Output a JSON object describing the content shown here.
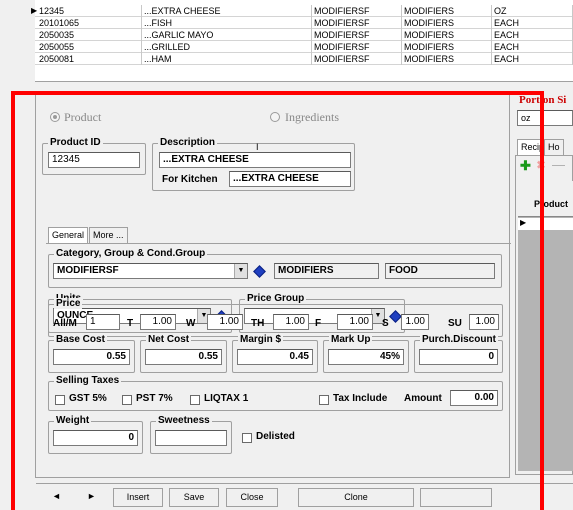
{
  "grid_rows": [
    {
      "id": "12345",
      "desc": "...EXTRA CHEESE",
      "c1": "MODIFIERSF",
      "c2": "MODIFIERS",
      "c3": "OZ",
      "selected": true
    },
    {
      "id": "20101065",
      "desc": "...FISH",
      "c1": "MODIFIERSF",
      "c2": "MODIFIERS",
      "c3": "EACH",
      "selected": false
    },
    {
      "id": "2050035",
      "desc": "...GARLIC MAYO",
      "c1": "MODIFIERSF",
      "c2": "MODIFIERS",
      "c3": "EACH",
      "selected": false
    },
    {
      "id": "2050055",
      "desc": "...GRILLED",
      "c1": "MODIFIERSF",
      "c2": "MODIFIERS",
      "c3": "EACH",
      "selected": false
    },
    {
      "id": "2050081",
      "desc": "...HAM",
      "c1": "MODIFIERSF",
      "c2": "MODIFIERS",
      "c3": "EACH",
      "selected": false
    }
  ],
  "mode": {
    "product": "Product",
    "ingredients": "Ingredients"
  },
  "product_id": {
    "label": "Product ID",
    "value": "12345"
  },
  "description": {
    "label": "Description",
    "value": "...EXTRA CHEESE",
    "kitchen_label": "For Kitchen",
    "kitchen_value": "...EXTRA CHEESE"
  },
  "tabs": {
    "general": "General",
    "more": "More ..."
  },
  "category": {
    "label": "Category, Group & Cond.Group",
    "value": "MODIFIERSF",
    "group": "MODIFIERS",
    "cond": "FOOD"
  },
  "units": {
    "label": "Units",
    "value": "OUNCE"
  },
  "price_group": {
    "label": "Price Group",
    "value": ""
  },
  "price": {
    "label": "Price",
    "allm_label": "All/M",
    "allm_value": "1",
    "items": [
      {
        "label": "T",
        "value": "1.00"
      },
      {
        "label": "W",
        "value": "1.00"
      },
      {
        "label": "TH",
        "value": "1.00"
      },
      {
        "label": "F",
        "value": "1.00"
      },
      {
        "label": "S",
        "value": "1.00"
      },
      {
        "label": "SU",
        "value": "1.00"
      }
    ]
  },
  "costs": {
    "base_label": "Base Cost",
    "base_value": "0.55",
    "net_label": "Net Cost",
    "net_value": "0.55",
    "margin_label": "Margin $",
    "margin_value": "0.45",
    "markup_label": "Mark Up",
    "markup_value": "45%",
    "discount_label": "Purch.Discount",
    "discount_value": "0"
  },
  "taxes": {
    "label": "Selling Taxes",
    "gst": "GST 5%",
    "pst": "PST 7%",
    "liq": "LIQTAX 1",
    "include": "Tax Include",
    "amount_label": "Amount",
    "amount_value": "0.00"
  },
  "weight": {
    "label": "Weight",
    "value": "0"
  },
  "sweetness": {
    "label": "Sweetness",
    "value": ""
  },
  "delisted": "Delisted",
  "toolbar": {
    "prev": "◄",
    "next": "►",
    "insert": "Insert",
    "save": "Save",
    "close": "Close",
    "clone": "Clone"
  },
  "right_panel": {
    "title": "Portion Si",
    "unit": "oz",
    "tab1": "Recip",
    "tab2": "Ho",
    "col": "Product"
  },
  "colors": {
    "red_frame": "#ff0000",
    "portion_title": "#cc0000"
  }
}
